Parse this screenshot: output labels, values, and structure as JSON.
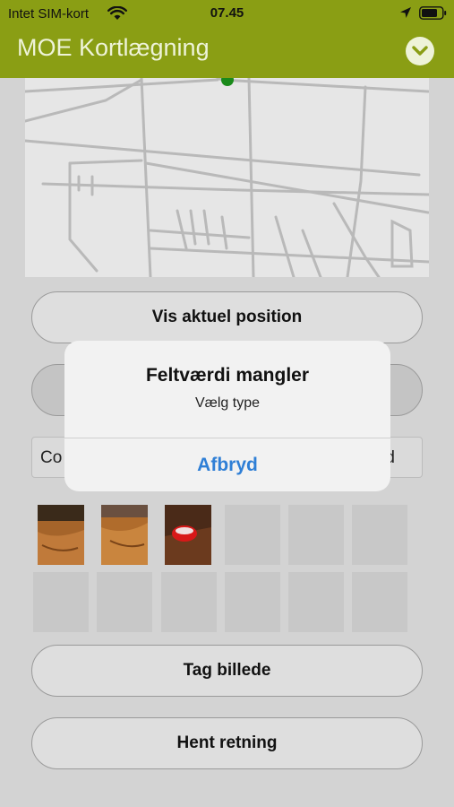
{
  "status_bar": {
    "carrier": "Intet SIM-kort",
    "time": "07.45",
    "icons": [
      "wifi-icon",
      "location-arrow-icon",
      "battery-icon"
    ]
  },
  "app_bar": {
    "title": "MOE Kortlægning",
    "menu_icon": "chevron-down-circle-icon"
  },
  "buttons": {
    "show_position": "Vis aktuel position",
    "take_photo": "Tag billede",
    "get_direction": "Hent retning"
  },
  "field_left_text": "Co",
  "field_right_text": "d",
  "photos": {
    "count_filled": 3,
    "slots": 12
  },
  "dialog": {
    "title": "Feltværdi mangler",
    "message": "Vælg type",
    "action": "Afbryd"
  },
  "colors": {
    "brand": "#8a9e14",
    "dialog_action": "#2f7fd6",
    "location_dot": "#1a8a1a"
  }
}
